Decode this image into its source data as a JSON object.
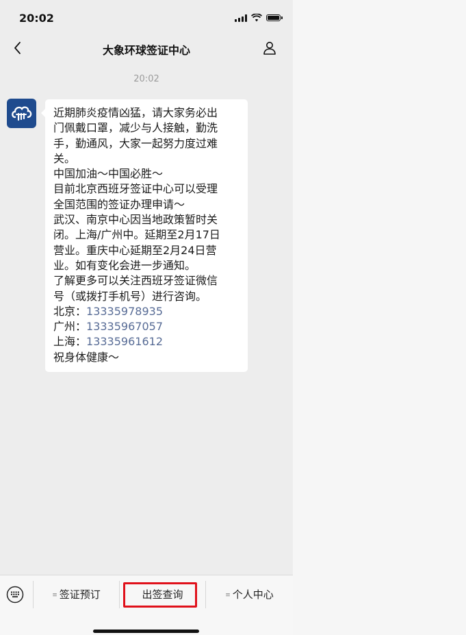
{
  "status_bar": {
    "time": "20:02"
  },
  "nav": {
    "title": "大象环球签证中心",
    "back_icon": "chevron-left-icon",
    "profile_icon": "person-icon"
  },
  "chat": {
    "timestamp": "20:02",
    "message": {
      "sender_avatar": "brand-logo",
      "lines": [
        "近期肺炎疫情凶猛，请大家务必出",
        "门佩戴口罩，减少与人接触，勤洗",
        "手，勤通风，大家一起努力度过难",
        "关。",
        "中国加油～中国必胜～",
        "目前北京西班牙签证中心可以受理",
        "全国范围的签证办理申请～",
        "武汉、南京中心因当地政策暂时关",
        "闭。上海/广州中。延期至2月17日",
        "营业。重庆中心延期至2月24日营",
        "业。如有变化会进一步通知。",
        "了解更多可以关注西班牙签证微信",
        "号（或拨打手机号）进行咨询。"
      ],
      "contacts": [
        {
          "label": "北京：",
          "number": "13335978935"
        },
        {
          "label": "广州：",
          "number": "13335967057"
        },
        {
          "label": "上海：",
          "number": "13335961612"
        }
      ],
      "closing": "祝身体健康～"
    }
  },
  "bottom_menu": {
    "keyboard_icon": "keyboard-icon",
    "items": [
      {
        "label": "签证预订",
        "has_submenu": true
      },
      {
        "label": "出签查询",
        "has_submenu": false,
        "highlighted": true
      },
      {
        "label": "个人中心",
        "has_submenu": true
      }
    ],
    "highlight_color": "#e0101a"
  },
  "colors": {
    "link": "#576b95",
    "avatar": "#1f4b8e",
    "chat_bg": "#ededed"
  }
}
